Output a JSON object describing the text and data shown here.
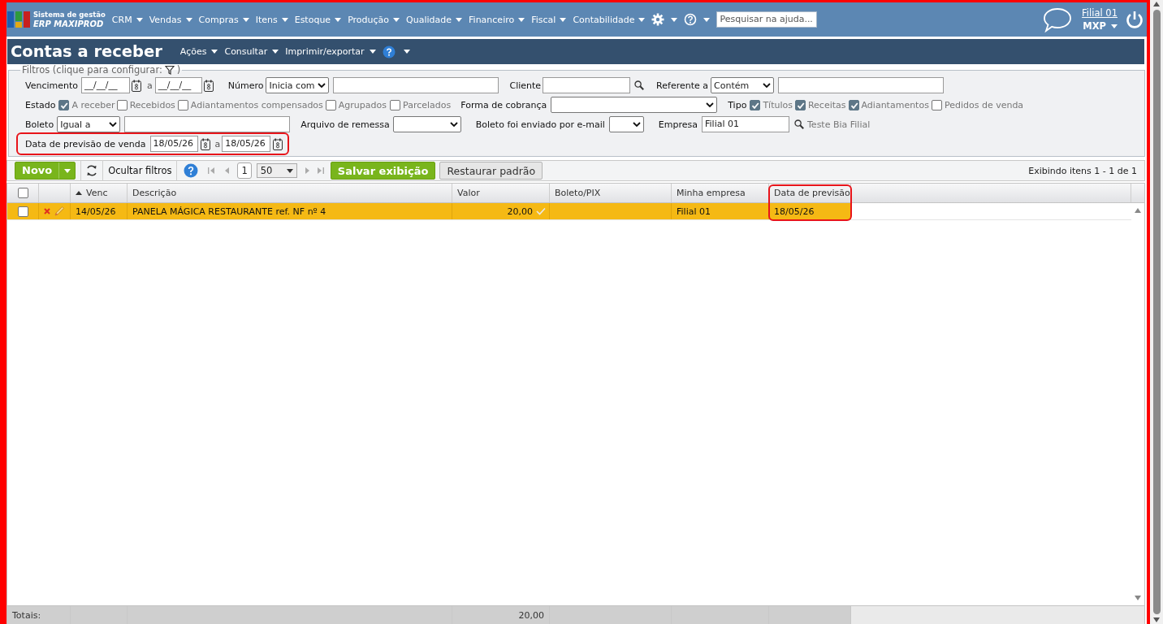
{
  "app": {
    "logo_line1": "Sistema de gestão",
    "logo_line2": "ERP MAXIPROD"
  },
  "nav": {
    "menus": [
      {
        "label": "CRM"
      },
      {
        "label": "Vendas"
      },
      {
        "label": "Compras"
      },
      {
        "label": "Itens"
      },
      {
        "label": "Estoque"
      },
      {
        "label": "Produção"
      },
      {
        "label": "Qualidade"
      },
      {
        "label": "Financeiro"
      },
      {
        "label": "Fiscal"
      },
      {
        "label": "Contabilidade"
      }
    ],
    "search": {
      "placeholder": "Pesquisar na ajuda..."
    },
    "branch": "Filial 01",
    "user": "MXP"
  },
  "page": {
    "title": "Contas a receber",
    "actions": [
      "Ações",
      "Consultar",
      "Imprimir/exportar"
    ]
  },
  "filters": {
    "legend": "Filtros (clique para configurar:",
    "legend_end": ")",
    "rows": [
      {
        "highlighted": false,
        "items": [
          {
            "kind": "label",
            "text": "Vencimento"
          },
          {
            "kind": "date",
            "value": "__/__/__"
          },
          {
            "kind": "calendar"
          },
          {
            "kind": "sep",
            "text": "a"
          },
          {
            "kind": "date",
            "value": "__/__/__"
          },
          {
            "kind": "calendar"
          },
          {
            "kind": "label",
            "text": "Número"
          },
          {
            "kind": "select",
            "value": "Inicia com"
          },
          {
            "kind": "input"
          },
          {
            "kind": "label",
            "text": "Cliente"
          },
          {
            "kind": "input"
          },
          {
            "kind": "search"
          },
          {
            "kind": "label",
            "text": "Referente a"
          },
          {
            "kind": "select",
            "value": "Contém"
          },
          {
            "kind": "input"
          }
        ]
      },
      {
        "highlighted": false,
        "items": [
          {
            "kind": "label",
            "text": "Estado"
          },
          {
            "kind": "checkbox",
            "label": "A receber",
            "checked": true
          },
          {
            "kind": "checkbox",
            "label": "Recebidos",
            "checked": false
          },
          {
            "kind": "checkbox",
            "label": "Adiantamentos compensados",
            "checked": false
          },
          {
            "kind": "checkbox",
            "label": "Agrupados",
            "checked": false
          },
          {
            "kind": "checkbox",
            "label": "Parcelados",
            "checked": false
          },
          {
            "kind": "label",
            "text": "Forma de cobrança"
          },
          {
            "kind": "select"
          },
          {
            "kind": "label",
            "text": "Tipo"
          },
          {
            "kind": "checkbox",
            "label": "Títulos",
            "checked": true
          },
          {
            "kind": "checkbox",
            "label": "Receitas",
            "checked": true
          },
          {
            "kind": "checkbox",
            "label": "Adiantamentos",
            "checked": true
          },
          {
            "kind": "checkbox",
            "label": "Pedidos de venda",
            "checked": false
          }
        ]
      },
      {
        "highlighted": false,
        "items": [
          {
            "kind": "label",
            "text": "Boleto"
          },
          {
            "kind": "select",
            "value": "Igual a"
          },
          {
            "kind": "input"
          },
          {
            "kind": "label",
            "text": "Arquivo de remessa"
          },
          {
            "kind": "select"
          },
          {
            "kind": "label",
            "text": "Boleto foi enviado por e-mail"
          },
          {
            "kind": "select"
          },
          {
            "kind": "label",
            "text": "Empresa"
          },
          {
            "kind": "input",
            "value": "Filial 01"
          },
          {
            "kind": "search"
          },
          {
            "kind": "note",
            "text": "Teste Bia Filial"
          }
        ]
      },
      {
        "highlighted": true,
        "items": [
          {
            "kind": "label",
            "text": "Data de previsão de venda"
          },
          {
            "kind": "date",
            "value": "18/05/26"
          },
          {
            "kind": "calendar"
          },
          {
            "kind": "sep",
            "text": "a"
          },
          {
            "kind": "date",
            "value": "18/05/26"
          },
          {
            "kind": "calendar"
          }
        ]
      }
    ]
  },
  "toolbar": {
    "new_button": "Novo",
    "hide_filters": "Ocultar filtros",
    "page": "1",
    "page_size": "50",
    "save_view": "Salvar exibição",
    "restore_default": "Restaurar padrão",
    "status": "Exibindo itens 1 - 1 de 1"
  },
  "grid": {
    "all_checked": false,
    "columns": [
      {
        "label": "Venc",
        "sorted": true,
        "highlighted": false
      },
      {
        "label": "Descrição",
        "sorted": false,
        "highlighted": false
      },
      {
        "label": "Valor",
        "sorted": false,
        "highlighted": false
      },
      {
        "label": "Boleto/PIX",
        "sorted": false,
        "highlighted": false
      },
      {
        "label": "Minha empresa",
        "sorted": false,
        "highlighted": false
      },
      {
        "label": "Data de previsão",
        "sorted": false,
        "highlighted": true
      }
    ],
    "rows": [
      {
        "checked": false,
        "color": "#f5b914",
        "confirmed": true,
        "cells": [
          "14/05/26",
          "PANELA MÁGICA RESTAURANTE ref. NF nº 4",
          "20,00",
          null,
          "Filial 01",
          "18/05/26"
        ]
      }
    ],
    "totals": {
      "label": "Totais:",
      "valor": "20,00"
    }
  }
}
